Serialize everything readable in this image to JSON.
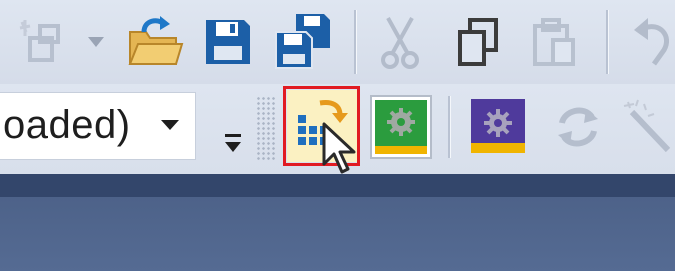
{
  "toolbar_top": {
    "buttons": [
      {
        "name": "new-project-button",
        "icon": "new-project-icon"
      },
      {
        "name": "new-project-dropdown-button",
        "icon": "chevron-down-icon"
      },
      {
        "name": "open-button",
        "icon": "open-folder-icon"
      },
      {
        "name": "save-button",
        "icon": "save-icon"
      },
      {
        "name": "save-all-button",
        "icon": "save-all-icon"
      },
      {
        "name": "cut-button",
        "icon": "scissors-icon"
      },
      {
        "name": "copy-button",
        "icon": "copy-icon"
      },
      {
        "name": "paste-button",
        "icon": "paste-icon"
      },
      {
        "name": "undo-button",
        "icon": "undo-icon"
      }
    ]
  },
  "toolbar_bottom": {
    "configuration_combo": {
      "value": "oaded)"
    },
    "overflow_icon": "overflow-chevron-icon",
    "buttons": [
      {
        "name": "import-button",
        "icon": "import-grid-arrow-icon",
        "highlighted": true
      },
      {
        "name": "build-gear-green-button",
        "icon": "gear-green-screen-icon"
      },
      {
        "name": "build-gear-purple-button",
        "icon": "gear-purple-screen-icon"
      },
      {
        "name": "refresh-button",
        "icon": "refresh-arrows-icon"
      },
      {
        "name": "magic-wand-button",
        "icon": "magic-wand-icon"
      }
    ]
  },
  "colors": {
    "highlight_border": "#e11b22",
    "hover_background": "#fbf1c2",
    "dark_strip": "#33466b",
    "content_area": "#52678f"
  }
}
